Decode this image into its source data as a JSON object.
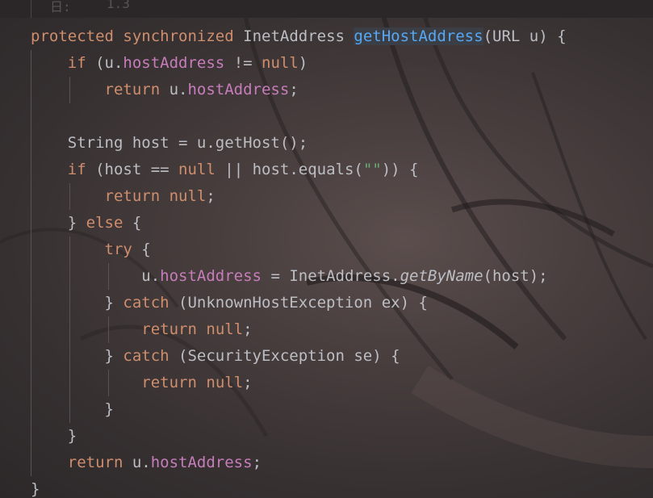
{
  "editor": {
    "top_hint": [
      "日:",
      "1.3"
    ],
    "lines": [
      [
        {
          "t": "protected",
          "c": "kw"
        },
        {
          "t": " ",
          "c": "pl"
        },
        {
          "t": "synchronized",
          "c": "kw"
        },
        {
          "t": " InetAddress ",
          "c": "pl"
        },
        {
          "t": "getHostAddress",
          "c": "fn fn-hl"
        },
        {
          "t": "(URL u) {",
          "c": "pl"
        }
      ],
      [
        {
          "t": "    ",
          "c": "pl"
        },
        {
          "t": "if",
          "c": "kw"
        },
        {
          "t": " (u.",
          "c": "pl"
        },
        {
          "t": "hostAddress",
          "c": "fld"
        },
        {
          "t": " != ",
          "c": "pl"
        },
        {
          "t": "null",
          "c": "kw"
        },
        {
          "t": ")",
          "c": "pl"
        }
      ],
      [
        {
          "t": "        ",
          "c": "pl"
        },
        {
          "t": "return",
          "c": "kw"
        },
        {
          "t": " u.",
          "c": "pl"
        },
        {
          "t": "hostAddress",
          "c": "fld"
        },
        {
          "t": ";",
          "c": "pl"
        }
      ],
      [],
      [
        {
          "t": "    String host = u.getHost();",
          "c": "pl"
        }
      ],
      [
        {
          "t": "    ",
          "c": "pl"
        },
        {
          "t": "if",
          "c": "kw"
        },
        {
          "t": " (host == ",
          "c": "pl"
        },
        {
          "t": "null",
          "c": "kw"
        },
        {
          "t": " || host.equals(",
          "c": "pl"
        },
        {
          "t": "\"\"",
          "c": "st"
        },
        {
          "t": ")) {",
          "c": "pl"
        }
      ],
      [
        {
          "t": "        ",
          "c": "pl"
        },
        {
          "t": "return",
          "c": "kw"
        },
        {
          "t": " ",
          "c": "pl"
        },
        {
          "t": "null",
          "c": "kw"
        },
        {
          "t": ";",
          "c": "pl"
        }
      ],
      [
        {
          "t": "    } ",
          "c": "pl"
        },
        {
          "t": "else",
          "c": "kw"
        },
        {
          "t": " {",
          "c": "pl"
        }
      ],
      [
        {
          "t": "        ",
          "c": "pl"
        },
        {
          "t": "try",
          "c": "kw"
        },
        {
          "t": " {",
          "c": "pl"
        }
      ],
      [
        {
          "t": "            u.",
          "c": "pl"
        },
        {
          "t": "hostAddress",
          "c": "fld"
        },
        {
          "t": " = InetAddress.",
          "c": "pl"
        },
        {
          "t": "getByName",
          "c": "it"
        },
        {
          "t": "(host);",
          "c": "pl"
        }
      ],
      [
        {
          "t": "        } ",
          "c": "pl"
        },
        {
          "t": "catch",
          "c": "kw"
        },
        {
          "t": " (UnknownHostException ex) {",
          "c": "pl"
        }
      ],
      [
        {
          "t": "            ",
          "c": "pl"
        },
        {
          "t": "return",
          "c": "kw"
        },
        {
          "t": " ",
          "c": "pl"
        },
        {
          "t": "null",
          "c": "kw"
        },
        {
          "t": ";",
          "c": "pl"
        }
      ],
      [
        {
          "t": "        } ",
          "c": "pl"
        },
        {
          "t": "catch",
          "c": "kw"
        },
        {
          "t": " (SecurityException se) {",
          "c": "pl"
        }
      ],
      [
        {
          "t": "            ",
          "c": "pl"
        },
        {
          "t": "return",
          "c": "kw"
        },
        {
          "t": " ",
          "c": "pl"
        },
        {
          "t": "null",
          "c": "kw"
        },
        {
          "t": ";",
          "c": "pl"
        }
      ],
      [
        {
          "t": "        }",
          "c": "pl"
        }
      ],
      [
        {
          "t": "    }",
          "c": "pl"
        }
      ],
      [
        {
          "t": "    ",
          "c": "pl"
        },
        {
          "t": "return",
          "c": "kw"
        },
        {
          "t": " u.",
          "c": "pl"
        },
        {
          "t": "hostAddress",
          "c": "fld"
        },
        {
          "t": ";",
          "c": "pl"
        }
      ],
      [
        {
          "t": "}",
          "c": "pl"
        }
      ]
    ]
  },
  "colors": {
    "keyword": "#cf8e6d",
    "field": "#c77dbb",
    "method_declaration": "#56a8f5",
    "string": "#6aab73",
    "plain": "#bcbec4"
  }
}
